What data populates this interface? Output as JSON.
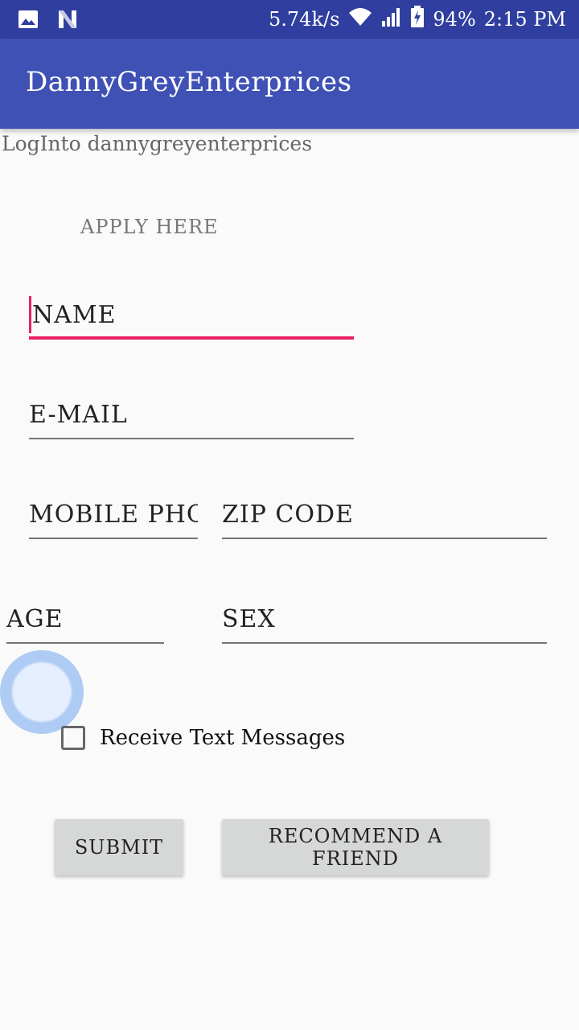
{
  "status_bar": {
    "speed": "5.74k/s",
    "battery": "94%",
    "time": "2:15 PM",
    "icons": [
      "image-icon",
      "n-notification-icon",
      "wifi-icon",
      "signal-icon",
      "battery-icon"
    ]
  },
  "app_bar": {
    "title": "DannyGreyEnterprices"
  },
  "subtitle": "LogInto dannygreyenterprices",
  "heading": "APPLY HERE",
  "form": {
    "name": "NAME",
    "email": "E-MAIL",
    "mobile": "MOBILE PHONE",
    "zip": "ZIP CODE",
    "age": "AGE",
    "sex": "SEX",
    "receive_text_label": "Receive Text Messages",
    "receive_text_checked": false
  },
  "buttons": {
    "submit": "SUBMIT",
    "recommend": "RECOMMEND A FRIEND"
  },
  "colors": {
    "status_bar": "#303f9f",
    "app_bar": "#3f51b5",
    "accent": "#e91e63",
    "background": "#fafafa",
    "button": "#d6d7d7"
  }
}
